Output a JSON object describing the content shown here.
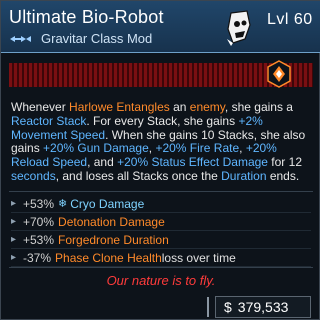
{
  "item": {
    "name": "Ultimate Bio-Robot",
    "level": "Lvl 60",
    "type": "Gravitar Class Mod"
  },
  "description": {
    "p1": "Whenever ",
    "p2": "Harlowe Entangles",
    "p3": " an ",
    "p4": "enemy",
    "p5": ", she gains a ",
    "p6": "Reactor Stack",
    "p7": ". For every Stack, she gains ",
    "p8": "+2% Movement Speed",
    "p9": ". When she gains 10 Stacks, she also gains ",
    "p10": "+20% Gun Damage",
    "p11": ", ",
    "p12": "+20% Fire Rate",
    "p13": ", ",
    "p14": "+20% Reload Speed",
    "p15": ", and ",
    "p16": "+20% Status Effect Damage",
    "p17": " for 12 ",
    "p18": "seconds",
    "p19": ", and loses all Stacks once the ",
    "p20": "Duration",
    "p21": " ends."
  },
  "stats": [
    {
      "value": "+53%",
      "name": "Cryo Damage",
      "tail": ""
    },
    {
      "value": "+70%",
      "name": "Detonation Damage",
      "tail": ""
    },
    {
      "value": "+53%",
      "name": "Forgedrone Duration",
      "tail": ""
    },
    {
      "value": "-37%",
      "name": "Phase Clone Health",
      "tail": " loss over time"
    }
  ],
  "flavor": "Our nature is to fly.",
  "price": {
    "currency": "$",
    "amount": "379,533"
  },
  "icons": [
    "robot-head-icon",
    "class-mod-icon",
    "legendary-emblem-icon",
    "snowflake-icon"
  ],
  "colors": {
    "accent": "#ff8a2a",
    "header": "#20466a",
    "rarity": "#7a0f12",
    "flavor": "#ff3b3b"
  }
}
